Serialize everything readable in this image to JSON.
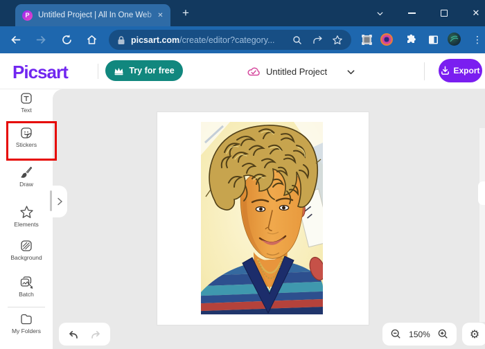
{
  "window": {
    "tab": {
      "title": "Untitled Project | All In One Web"
    },
    "glyphs": {
      "new_tab": "+",
      "tab_close": "✕",
      "window_close": "✕",
      "menu_kebab": "⋮",
      "gear": "⚙"
    }
  },
  "browser": {
    "url": {
      "domain": "picsart.com",
      "path": "/create/editor?category..."
    }
  },
  "app_header": {
    "logo": "Picsart",
    "try_for_free": "Try for free",
    "project_name": "Untitled Project",
    "export": "Export"
  },
  "sidebar": {
    "items": [
      {
        "label": "Text"
      },
      {
        "label": "Stickers",
        "highlighted": true
      },
      {
        "label": "Draw"
      },
      {
        "label": "Elements"
      },
      {
        "label": "Background"
      },
      {
        "label": "Batch"
      },
      {
        "label": "My Folders"
      }
    ]
  },
  "footer": {
    "zoom_level": "150%"
  },
  "canvas": {
    "image_description": "Stylized cartoon portrait of a young man with curly blond hair, gold chain necklace and blue striped v-neck shirt, holding a white card"
  },
  "colors": {
    "titlebar_navy": "#12395f",
    "toolbar_blue": "#1e67ae",
    "address_pill_blue": "#174e84",
    "accent_purple": "#7127f0",
    "teal_button": "#11877e",
    "export_purple": "#7a1ef0",
    "cloud_pink": "#d64a9e",
    "highlight_red": "#e60400"
  }
}
